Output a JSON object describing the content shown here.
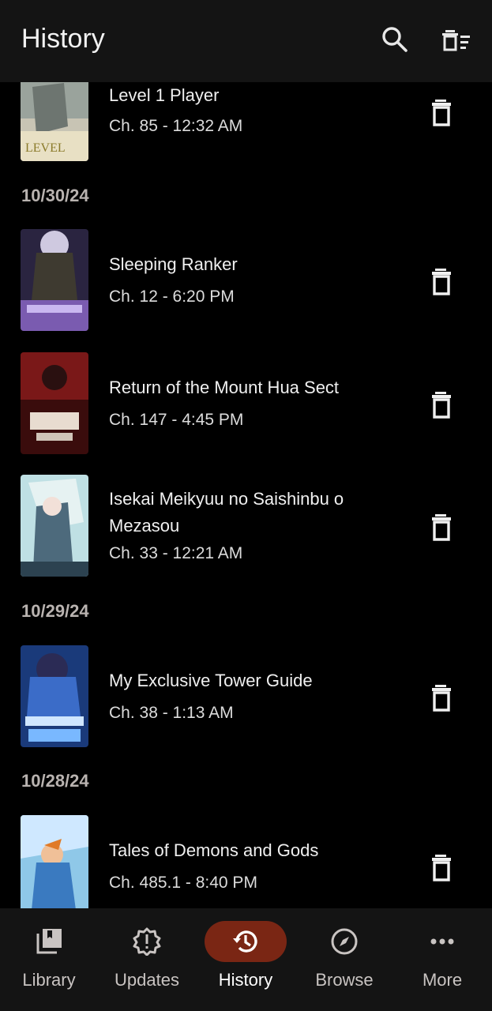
{
  "header": {
    "title": "History",
    "search_icon": "search-icon",
    "clear_icon": "delete-sweep-icon"
  },
  "sections": [
    {
      "date": "",
      "items": [
        {
          "title": "Level 1 Player",
          "subtitle": "Ch. 85 - 12:32 AM"
        }
      ]
    },
    {
      "date": "10/30/24",
      "items": [
        {
          "title": "Sleeping Ranker",
          "subtitle": "Ch. 12 - 6:20 PM"
        },
        {
          "title": "Return of the Mount Hua Sect",
          "subtitle": "Ch. 147 - 4:45 PM"
        },
        {
          "title": "Isekai Meikyuu no Saishinbu o Mezasou",
          "subtitle": "Ch. 33 - 12:21 AM"
        }
      ]
    },
    {
      "date": "10/29/24",
      "items": [
        {
          "title": "My Exclusive Tower Guide",
          "subtitle": "Ch. 38 - 1:13 AM"
        }
      ]
    },
    {
      "date": "10/28/24",
      "items": [
        {
          "title": "Tales of Demons and Gods",
          "subtitle": "Ch. 485.1 - 8:40 PM"
        }
      ]
    }
  ],
  "nav": [
    {
      "label": "Library",
      "icon": "library-icon"
    },
    {
      "label": "Updates",
      "icon": "updates-icon"
    },
    {
      "label": "History",
      "icon": "history-icon",
      "active": true
    },
    {
      "label": "Browse",
      "icon": "compass-icon"
    },
    {
      "label": "More",
      "icon": "more-icon"
    }
  ],
  "colors": {
    "active_pill": "#7a2614",
    "bar_bg": "#141414",
    "date_text": "#b9b3b0"
  }
}
